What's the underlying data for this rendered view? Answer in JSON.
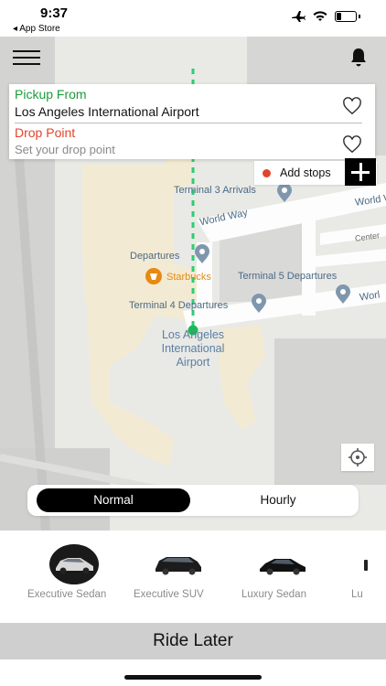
{
  "status_bar": {
    "time": "9:37",
    "back_app": "◂ App Store"
  },
  "location": {
    "pickup_label": "Pickup From",
    "pickup_value": "Los Angeles International Airport",
    "drop_label": "Drop Point",
    "drop_placeholder": "Set your drop point",
    "add_stops_label": "Add stops"
  },
  "map": {
    "labels": {
      "terminal3": "Terminal 3 Arrivals",
      "world_way": "World Way",
      "world_right": "World W",
      "world_lower": "Worl",
      "center": "Center",
      "departures": "Departures",
      "starbucks": "Starbucks",
      "terminal5": "Terminal 5 Departures",
      "terminal4": "Terminal 4 Departures",
      "lax_line1": "Los Angeles",
      "lax_line2": "International",
      "lax_line3": "Airport"
    }
  },
  "ride_type": {
    "normal": "Normal",
    "hourly": "Hourly",
    "selected": "Normal"
  },
  "vehicles": [
    {
      "name": "Executive Sedan",
      "selected": true
    },
    {
      "name": "Executive SUV",
      "selected": false
    },
    {
      "name": "Luxury Sedan",
      "selected": false
    },
    {
      "name": "Lu",
      "selected": false
    }
  ],
  "footer": {
    "ride_later": "Ride Later"
  },
  "colors": {
    "pickup": "#1c9c3c",
    "drop": "#e0452b",
    "route": "#2ecc71",
    "poi": "#7f97ad",
    "starbucks": "#e68a12"
  },
  "icons": [
    "menu-icon",
    "bell-icon",
    "heart-icon",
    "plus-icon",
    "locate-icon",
    "map-pin-icon",
    "starbucks-icon"
  ]
}
